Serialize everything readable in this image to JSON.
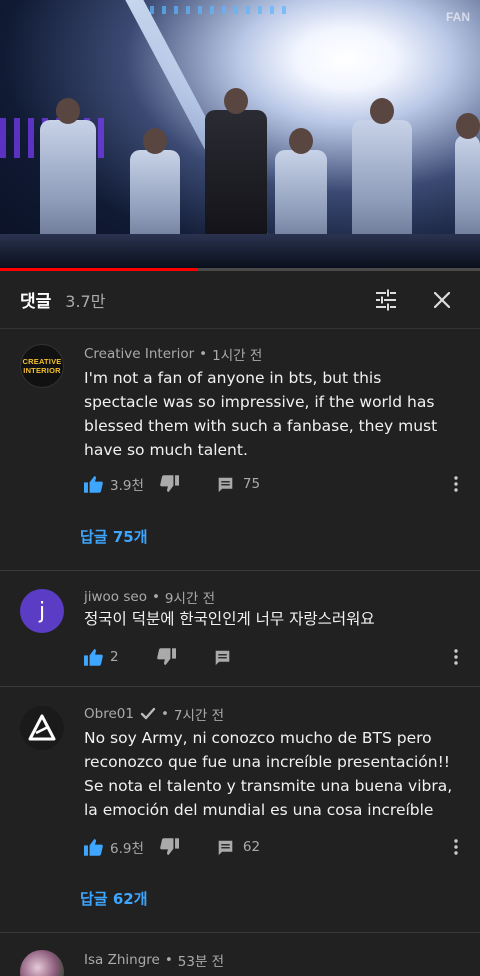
{
  "video": {
    "progress": 0.41,
    "watermark": "FAN"
  },
  "header": {
    "title": "댓글",
    "count": "3.7만"
  },
  "comments": [
    {
      "avatar": {
        "type": "logo",
        "lines": [
          "CREATIVE",
          "INTERIOR"
        ]
      },
      "author": "Creative Interior",
      "time": "1시간 전",
      "text": "I'm not a fan of anyone in bts, but this spectacle was so impressive, if the world has blessed them with such a fanbase, they must have so much talent.",
      "likes": "3.9천",
      "reply_count": "75",
      "replies_label": "답글 75개"
    },
    {
      "avatar": {
        "type": "letter",
        "letter": "j"
      },
      "author": "jiwoo seo",
      "time": "9시간 전",
      "text": "정국이 덕분에 한국인인게 너무 자랑스러워요",
      "likes": "2",
      "reply_count": ""
    },
    {
      "avatar": {
        "type": "logo-triangle"
      },
      "author": "Obre01",
      "verified": true,
      "time": "7시간 전",
      "text": "No soy Army, ni conozco mucho de BTS pero reconozco que fue una increíble presentación!! Se nota el talento y transmite una buena vibra, la emoción del mundial es una cosa increíble",
      "likes": "6.9천",
      "reply_count": "62",
      "replies_label": "답글 62개"
    },
    {
      "avatar": {
        "type": "photo"
      },
      "author": "Isa Zhingre",
      "time": "53분 전"
    }
  ],
  "colors": {
    "background": "#212121",
    "link": "#3ea6ff",
    "like_active": "#3ea6ff",
    "progress": "#ff0000"
  }
}
